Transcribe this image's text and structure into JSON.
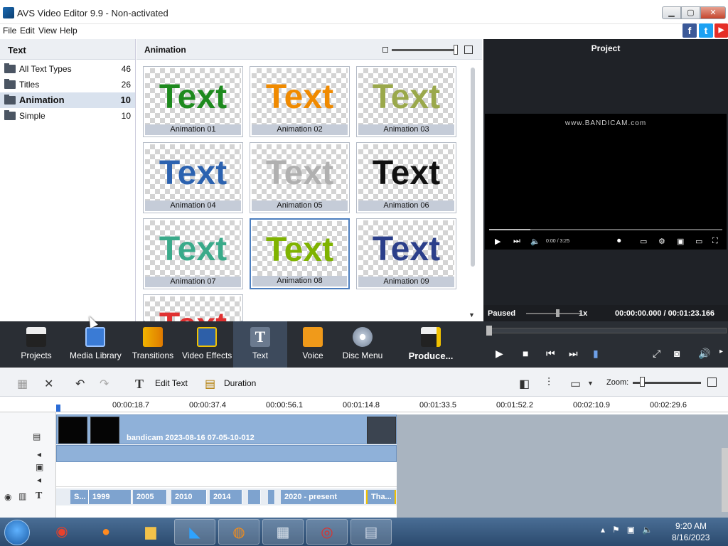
{
  "window": {
    "title": "AVS Video Editor 9.9 - Non-activated",
    "min": "▁",
    "max": "▢",
    "close": "✕"
  },
  "menu": [
    "File",
    "Edit",
    "View",
    "Help"
  ],
  "social": {
    "facebook": "f",
    "twitter": "t",
    "youtube": "▶"
  },
  "left_panel": {
    "title": "Text",
    "categories": [
      {
        "label": "All Text Types",
        "count": "46"
      },
      {
        "label": "Titles",
        "count": "26"
      },
      {
        "label": "Animation",
        "count": "10"
      },
      {
        "label": "Simple",
        "count": "10"
      }
    ],
    "selected_index": 2
  },
  "center_panel": {
    "title": "Animation",
    "tiles": [
      {
        "word": "Text",
        "label": "Animation 01",
        "color": "#1e8a1e"
      },
      {
        "word": "Text",
        "label": "Animation 02",
        "color": "#f08a00"
      },
      {
        "word": "Text",
        "label": "Animation 03",
        "color": "#9aa84b"
      },
      {
        "word": "Text",
        "label": "Animation 04",
        "color": "#2b62b0"
      },
      {
        "word": "Text",
        "label": "Animation 05",
        "color": "#b0b0b0"
      },
      {
        "word": "Text",
        "label": "Animation 06",
        "color": "#111111"
      },
      {
        "word": "Text",
        "label": "Animation 07",
        "color": "#3aaa8a"
      },
      {
        "word": "Text",
        "label": "Animation 08",
        "color": "#7fb300"
      },
      {
        "word": "Text",
        "label": "Animation 09",
        "color": "#2b3f8a"
      },
      {
        "word": "Text",
        "label": "",
        "color": "#e03030"
      }
    ],
    "selected_index": 7
  },
  "project_panel": {
    "title": "Project",
    "watermark": "www.BANDICAM.com",
    "yt_time": "0:00 / 3:25",
    "status": "Paused",
    "speed": "1x",
    "timecode": "00:00:00.000  /  00:01:23.166"
  },
  "toolbar": {
    "items": [
      {
        "label": "Projects"
      },
      {
        "label": "Media Library"
      },
      {
        "label": "Transitions"
      },
      {
        "label": "Video Effects"
      },
      {
        "label": "Text"
      },
      {
        "label": "Voice"
      },
      {
        "label": "Disc Menu"
      },
      {
        "label": "Produce..."
      }
    ],
    "selected_index": 4
  },
  "timeline_toolbar": {
    "edit_text": "Edit Text",
    "duration": "Duration",
    "zoom_label": "Zoom:"
  },
  "ruler_ticks": [
    "00:00:18.7",
    "00:00:37.4",
    "00:00:56.1",
    "00:01:14.8",
    "00:01:33.5",
    "00:01:52.2",
    "00:02:10.9",
    "00:02:29.6"
  ],
  "video_clip_title": "bandicam 2023-08-16 07-05-10-012",
  "text_clips": [
    "S...",
    "1999",
    "2005",
    "2010",
    "2014",
    "",
    "",
    "2020 - present",
    "Tha..."
  ],
  "taskbar": {
    "time": "9:20 AM",
    "date": "8/16/2023"
  }
}
